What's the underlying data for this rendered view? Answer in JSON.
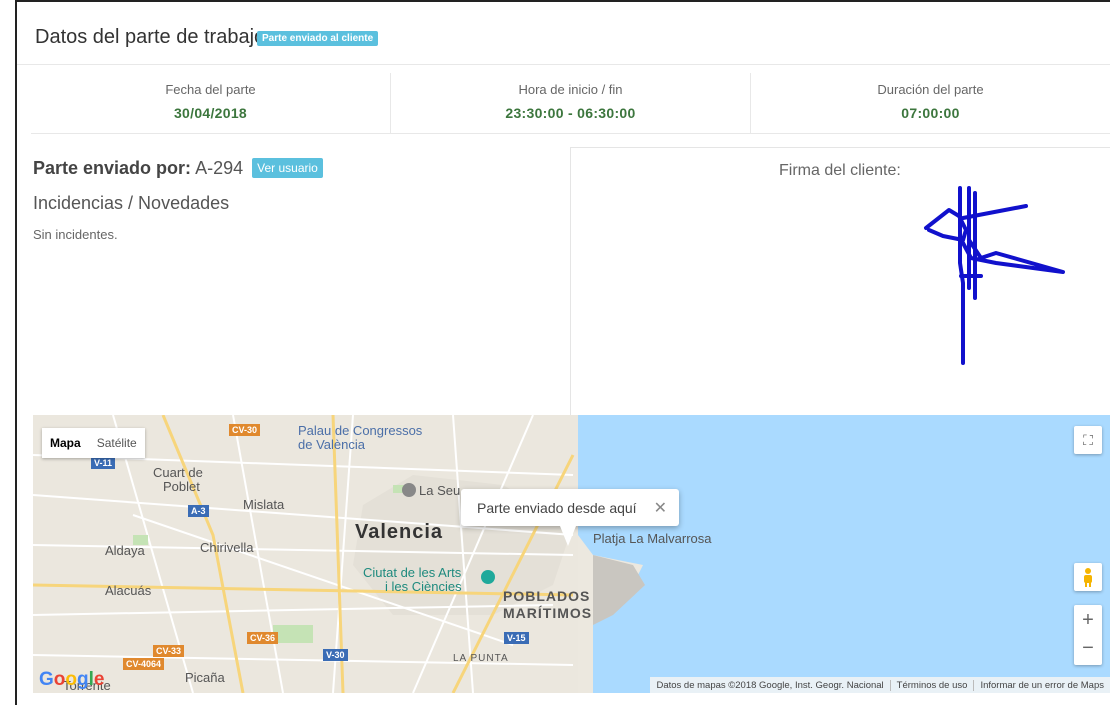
{
  "header": {
    "title": "Datos del parte de trabajo",
    "badge": "Parte enviado al cliente"
  },
  "stats": [
    {
      "label": "Fecha del parte",
      "value": "30/04/2018"
    },
    {
      "label": "Hora de inicio / fin",
      "value": "23:30:00 - 06:30:00"
    },
    {
      "label": "Duración del parte",
      "value": "07:00:00"
    }
  ],
  "sender": {
    "label": "Parte enviado por:",
    "user": "A-294",
    "button": "Ver usuario"
  },
  "incidents": {
    "title": "Incidencias / Novedades",
    "text": "Sin incidentes."
  },
  "signature": {
    "label": "Firma del cliente:"
  },
  "map": {
    "type_map": "Mapa",
    "type_satellite": "Satélite",
    "info": "Parte enviado desde aquí",
    "labels": {
      "valencia": "Valencia",
      "poblados1": "POBLADOS",
      "poblados2": "MARÍTIMOS",
      "palau1": "Palau de Congressos",
      "palau2": "de València",
      "cuart1": "Cuart de",
      "cuart2": "Poblet",
      "mislata": "Mislata",
      "aldaya": "Aldaya",
      "chirivella": "Chirivella",
      "alacuas": "Alacuás",
      "seu": "La Seu",
      "ciutat1": "Ciutat de les Arts",
      "ciutat2": "i les Ciències",
      "platja": "Platja La Malvarrosa",
      "lapunta": "LA PUNTA",
      "picana": "Picaña",
      "torrente": "Torrente"
    },
    "roads": {
      "cv30": "CV-30",
      "v11": "V-11",
      "a3": "A-3",
      "cv36": "CV-36",
      "cv33": "CV-33",
      "cv4064": "CV-4064",
      "v30": "V-30",
      "v15": "V-15"
    },
    "footer": {
      "data": "Datos de mapas ©2018 Google, Inst. Geogr. Nacional",
      "terms": "Términos de uso",
      "report": "Informar de un error de Maps"
    },
    "google": "Google"
  }
}
